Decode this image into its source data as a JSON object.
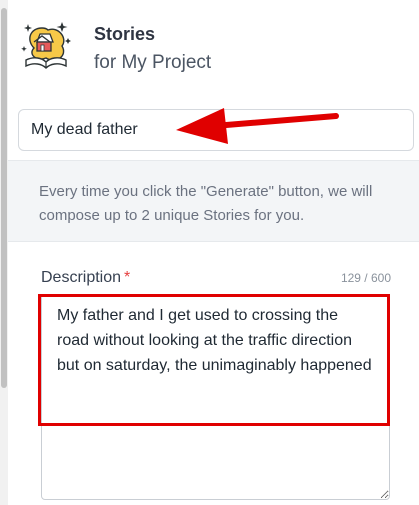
{
  "header": {
    "title": "Stories",
    "subtitle": "for My Project",
    "logo_icon": "book-storytelling-icon"
  },
  "story_name": {
    "value": "My dead father"
  },
  "info": {
    "text": "Every time you click the \"Generate\" button, we will compose up to 2 unique Stories for you."
  },
  "description": {
    "label": "Description",
    "required_mark": "*",
    "char_count": "129 / 600",
    "value": "My father and I get used to crossing the road without looking at the traffic direction but on saturday, the unimaginably happened"
  },
  "colors": {
    "annotation_red": "#e00000",
    "required_red": "#e53e3e",
    "info_bg": "#f3f5f7"
  }
}
